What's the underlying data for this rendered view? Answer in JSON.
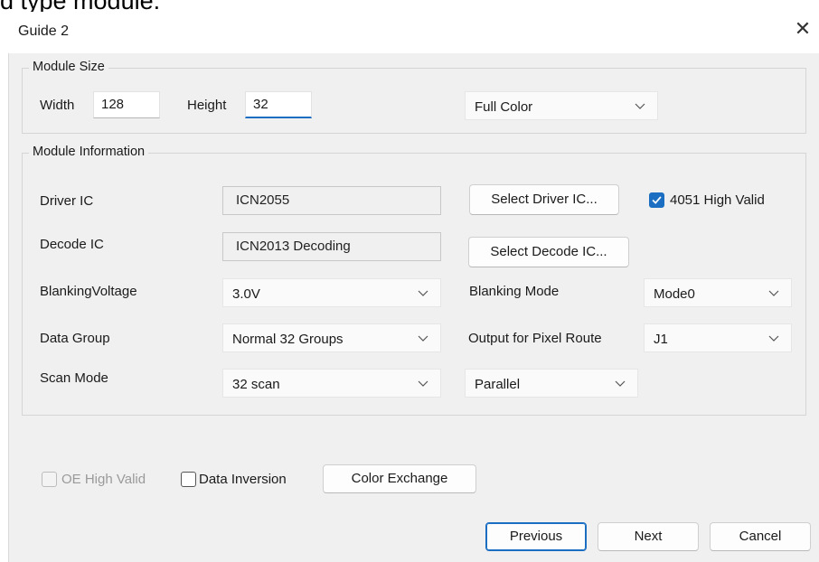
{
  "cutoff_text": "d type module.",
  "window": {
    "title": "Guide 2",
    "close_glyph": "✕"
  },
  "module_size": {
    "legend": "Module Size",
    "width_label": "Width",
    "width_value": "128",
    "height_label": "Height",
    "height_value": "32",
    "color_mode": "Full Color"
  },
  "module_info": {
    "legend": "Module Information",
    "driver_ic_label": "Driver IC",
    "driver_ic_value": "ICN2055",
    "select_driver_btn": "Select Driver IC...",
    "valid_4051_label": "4051 High Valid",
    "valid_4051_checked": true,
    "decode_ic_label": "Decode IC",
    "decode_ic_value": "ICN2013 Decoding",
    "select_decode_btn": "Select Decode IC...",
    "blanking_voltage_label": "BlankingVoltage",
    "blanking_voltage_value": "3.0V",
    "blanking_mode_label": "Blanking Mode",
    "blanking_mode_value": "Mode0",
    "data_group_label": "Data Group",
    "data_group_value": "Normal 32 Groups",
    "pixel_route_label": "Output for Pixel Route",
    "pixel_route_value": "J1",
    "scan_mode_label": "Scan Mode",
    "scan_mode_value": "32 scan",
    "scan_type_value": "Parallel"
  },
  "options": {
    "oe_high_valid_label": "OE High Valid",
    "oe_high_valid_enabled": false,
    "data_inversion_label": "Data Inversion",
    "data_inversion_checked": false,
    "color_exchange_btn": "Color Exchange"
  },
  "footer": {
    "previous": "Previous",
    "next": "Next",
    "cancel": "Cancel"
  },
  "colors": {
    "accent": "#1b6ec2",
    "dialog_bg": "#f0f0f0"
  },
  "icons": [
    "close-icon",
    "chevron-down-icon",
    "checkmark-icon"
  ]
}
